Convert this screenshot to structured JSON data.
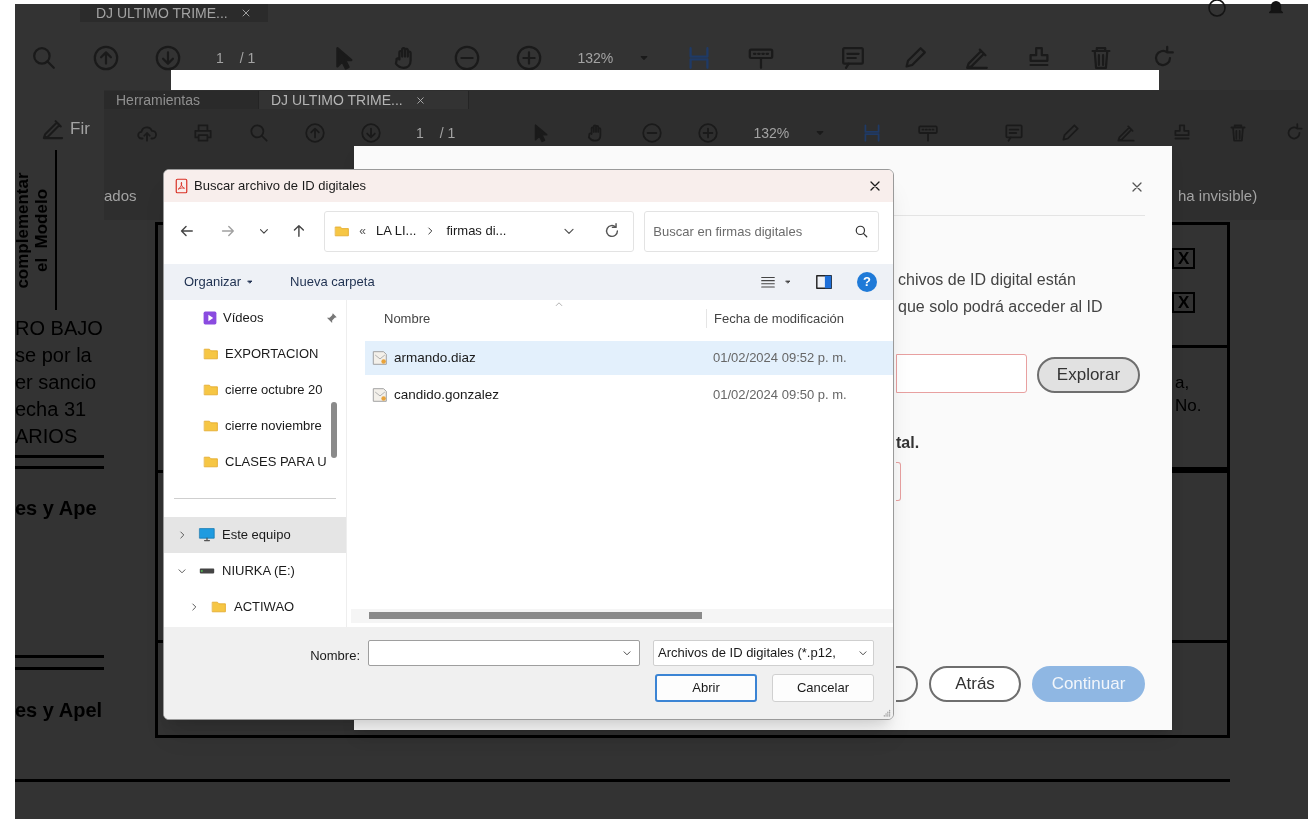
{
  "back_window": {
    "tab": "DJ ULTIMO TRIME...",
    "sign_label": "Fir",
    "page": "1",
    "page_total": "/ 1",
    "zoom": "132%"
  },
  "front_window": {
    "tabs": [
      {
        "label": "Herramientas",
        "selected": false
      },
      {
        "label": "DJ ULTIMO TRIME...",
        "selected": true
      }
    ],
    "page": "1",
    "page_total": "/ 1",
    "zoom": "132%",
    "left_text": "ados",
    "right_text": "ha invisible)"
  },
  "document": {
    "fragments": [
      {
        "text": "complementar",
        "kind": "vertical"
      },
      {
        "text": "el  Modelo",
        "kind": "vertical"
      },
      {
        "text": "RO BAJO",
        "kind": "line"
      },
      {
        "text": "se por la",
        "kind": "line"
      },
      {
        "text": "er sancio",
        "kind": "line"
      },
      {
        "text": "echa 31",
        "kind": "line"
      },
      {
        "text": "ARIOS",
        "kind": "line"
      },
      {
        "text": "es y Ape",
        "kind": "heading"
      },
      {
        "text": "es y Apel",
        "kind": "heading"
      },
      {
        "text": "X",
        "kind": "mark"
      },
      {
        "text": "X",
        "kind": "mark"
      },
      {
        "text": "a,",
        "kind": "line"
      },
      {
        "text": "No.",
        "kind": "line"
      }
    ]
  },
  "id_dialog": {
    "body_lines": [
      "chivos de ID digital están",
      "que solo podrá acceder al ID"
    ],
    "browse_button": "Explorar",
    "bold_text": "tal.",
    "buttons": [
      {
        "label": "Atrás",
        "kind": "outline",
        "disabled": false
      },
      {
        "label": "Continuar",
        "kind": "primary",
        "disabled": true
      }
    ]
  },
  "file_dialog": {
    "title": "Buscar archivo de ID digitales",
    "address": {
      "prefix": "«",
      "segments": [
        "LA LI...",
        "firmas di..."
      ]
    },
    "search": {
      "placeholder": "Buscar en firmas digitales"
    },
    "commands": {
      "organize": "Organizar",
      "new_folder": "Nueva carpeta",
      "help": "?"
    },
    "quick_access": [
      {
        "label": "Vídeos",
        "kind": "videos",
        "pinned": true,
        "selected": false
      },
      {
        "label": "EXPORTACION",
        "kind": "folder",
        "pinned": false,
        "selected": false
      },
      {
        "label": "cierre octubre 20",
        "kind": "folder",
        "pinned": false,
        "selected": false
      },
      {
        "label": "cierre noviembre",
        "kind": "folder",
        "pinned": false,
        "selected": false
      },
      {
        "label": "CLASES PARA U",
        "kind": "folder",
        "pinned": false,
        "selected": false
      }
    ],
    "tree": [
      {
        "label": "Este equipo",
        "kind": "pc",
        "expanded": false,
        "selected": true
      },
      {
        "label": "NIURKA (E:)",
        "kind": "drive",
        "expanded": true,
        "selected": false,
        "children": [
          {
            "label": "ACTIWAO",
            "kind": "folder",
            "expanded": false,
            "selected": false
          }
        ]
      }
    ],
    "columns": [
      "Nombre",
      "Fecha de modificación"
    ],
    "rows": [
      {
        "name": "armando.diaz",
        "modified": "01/02/2024 09:52 p. m.",
        "selected": true
      },
      {
        "name": "candido.gonzalez",
        "modified": "01/02/2024 09:50 p. m.",
        "selected": false
      }
    ],
    "name_label": "Nombre:",
    "filter": "Archivos de ID digitales (*.p12,",
    "buttons": [
      {
        "label": "Abrir",
        "kind": "default"
      },
      {
        "label": "Cancelar",
        "kind": "normal"
      }
    ]
  }
}
